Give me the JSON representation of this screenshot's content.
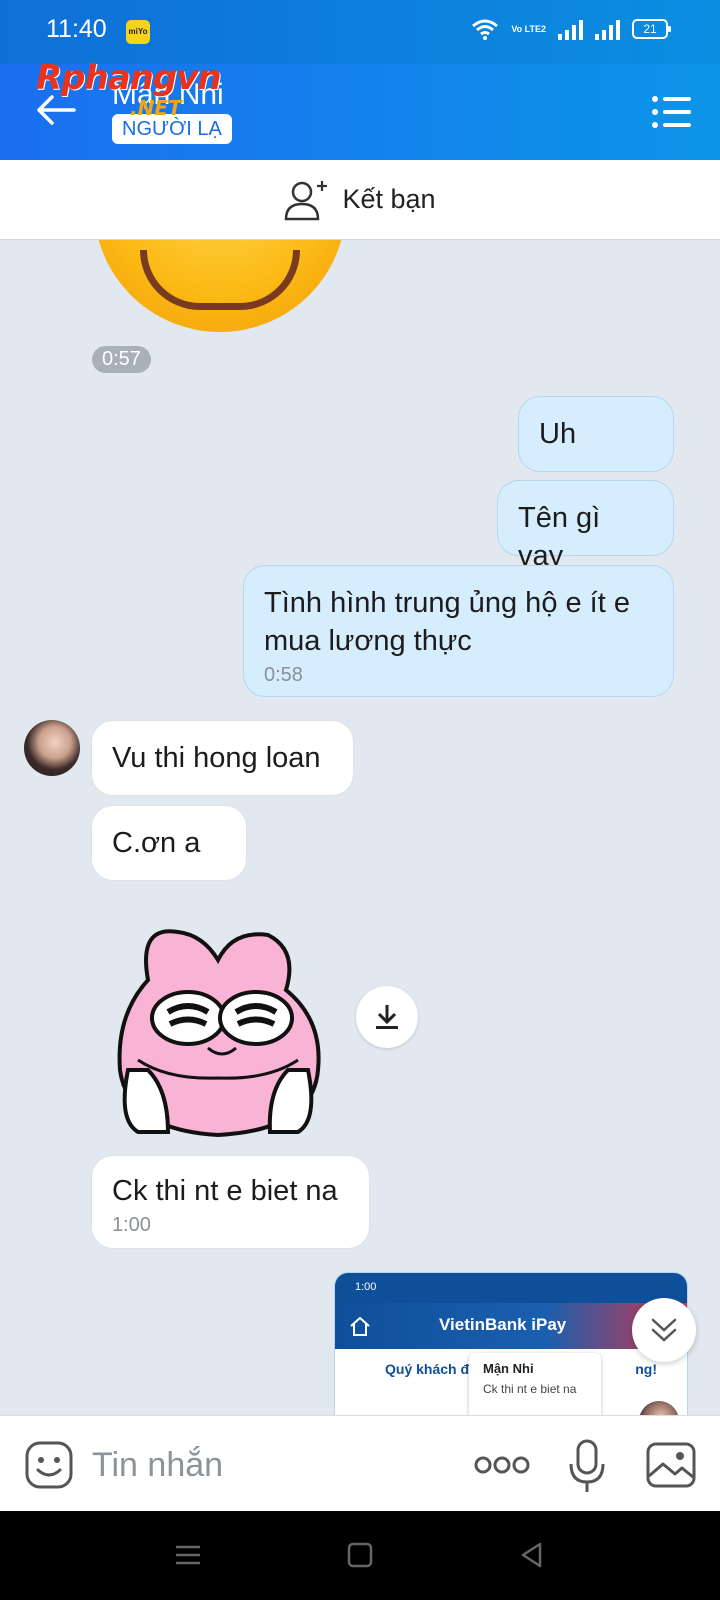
{
  "status_bar": {
    "time": "11:40",
    "app_badge": "miYo",
    "network_label": "Vo LTE2",
    "battery": "21"
  },
  "header": {
    "contact_name": "Mận Nhi",
    "badge": "NGƯỜI LẠ",
    "watermark": "Rphangvn",
    "watermark_sub": ".NET"
  },
  "add_friend": {
    "label": "Kết bạn"
  },
  "messages": {
    "time_pill": "0:57",
    "out": [
      {
        "text": "Uh"
      },
      {
        "text": "Tên gì vay"
      },
      {
        "text": "Tình hình trung ủng hộ e ít e mua lương thực",
        "time": "0:58"
      }
    ],
    "in": [
      {
        "text": "Vu thi hong loan"
      },
      {
        "text": "C.ơn a"
      },
      {
        "text": "Ck thi nt e biet na",
        "time": "1:00"
      }
    ]
  },
  "preview": {
    "status_time": "1:00",
    "bank_name": "VietinBank iPay",
    "greeting_start": "Quý khách đ",
    "greeting_end": "ng!",
    "notif_name": "Mận Nhi",
    "notif_msg": "Ck thi nt e biet na"
  },
  "input": {
    "placeholder": "Tin nhắn"
  },
  "colors": {
    "header_start": "#1b6ff0",
    "header_end": "#0b95e8",
    "out_bubble": "#d5edfc",
    "in_bubble": "#ffffff",
    "chat_bg": "#e2e8f0"
  }
}
